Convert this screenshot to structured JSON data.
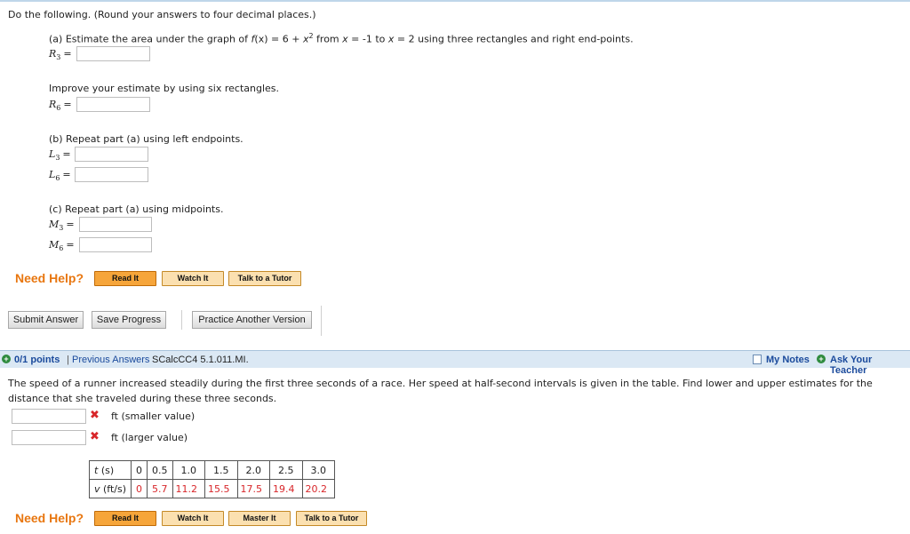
{
  "q1": {
    "instructions": "Do the following. (Round your answers to four decimal places.)",
    "part_a": {
      "pre": "(a) Estimate the area under the graph of ",
      "f": "f",
      "fx": "(x) = 6 + ",
      "x2": "x",
      "sup": "2",
      "mid": " from ",
      "x1": "x",
      "from_to": " = -1 to ",
      "x3": "x",
      "post": " = 2 using three rectangles and right end-points."
    },
    "improve": "Improve your estimate by using six rectangles.",
    "part_b": "(b) Repeat part (a) using left endpoints.",
    "part_c": "(c) Repeat part (a) using midpoints.",
    "labels": {
      "R3": "R",
      "R3s": "3",
      "R6": "R",
      "R6s": "6",
      "L3": "L",
      "L3s": "3",
      "L6": "L",
      "L6s": "6",
      "M3": "M",
      "M3s": "3",
      "M6": "M",
      "M6s": "6",
      "eq": "="
    },
    "answers": {
      "R3": "",
      "R6": "",
      "L3": "",
      "L6": "",
      "M3": "",
      "M6": ""
    },
    "need_help": "Need Help?",
    "help_buttons": {
      "read": "Read It",
      "watch": "Watch It",
      "tutor": "Talk to a Tutor"
    },
    "actions": {
      "submit": "Submit Answer",
      "save": "Save Progress",
      "practice": "Practice Another Version"
    }
  },
  "q2_bar": {
    "points": "0/1 points",
    "sep": "|",
    "previous": "Previous Answers",
    "code": "SCalcCC4 5.1.011.MI.",
    "my_notes": "My Notes",
    "ask_teacher": "Ask Your Teacher"
  },
  "q2": {
    "text1": "The speed of a runner increased steadily during the first three seconds of a race. Her speed at half-second intervals is given in the table. Find lower and upper estimates for the",
    "text2": "distance that she traveled during these three seconds.",
    "ans1_unit": "ft (smaller value)",
    "ans2_unit": "ft (larger value)",
    "answers": {
      "smaller": "",
      "larger": ""
    },
    "table": {
      "t_label": "t",
      "t_unit": " (s)",
      "v_label": "v",
      "v_unit": " (ft/s)",
      "t": [
        "0",
        "0.5",
        "1.0",
        "1.5",
        "2.0",
        "2.5",
        "3.0"
      ],
      "v": [
        "0",
        "5.7",
        "11.2",
        "15.5",
        "17.5",
        "19.4",
        "20.2"
      ]
    },
    "need_help": "Need Help?",
    "help_buttons": {
      "read": "Read It",
      "watch": "Watch It",
      "master": "Master It",
      "tutor": "Talk to a Tutor"
    }
  },
  "colors": {
    "help_orange": "#e8760f",
    "error_red": "#d8262a",
    "bar_blue": "#dbe8f4",
    "link_blue": "#1a4a9c"
  },
  "icons": [
    "x-mark-icon",
    "plus-circle-icon",
    "note-icon"
  ]
}
